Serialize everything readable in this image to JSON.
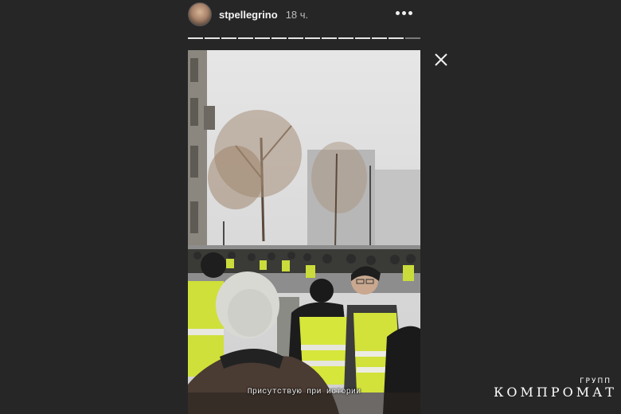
{
  "story": {
    "username": "stpellegrino",
    "time_ago": "18 ч.",
    "more_icon": "more-horizontal-icon",
    "close_icon": "close-icon",
    "segments_total": 14,
    "segments_done": 13,
    "caption": "Присутствую при истории"
  },
  "watermark": {
    "top_text": "ГРУПП",
    "main_text": "КОМПРОМАТ"
  },
  "colors": {
    "background": "#262626",
    "vest_yellow": "#d7e83a",
    "text": "#f2f2f2"
  }
}
